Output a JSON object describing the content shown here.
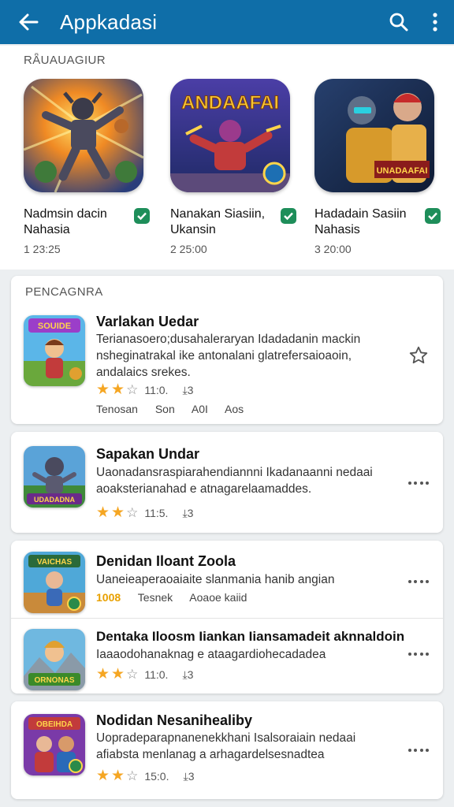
{
  "appbar": {
    "title": "Appkadasi",
    "colors": {
      "bar": "#0f6ea8"
    }
  },
  "featured": {
    "label": "RǞUAUAGIUR",
    "items": [
      {
        "name": "Nadmsin dacin Nahasia",
        "number": "1 23:25",
        "icon": "game-icon-warrior"
      },
      {
        "name": "Nanakan Siasiin, Ukansin",
        "number": "2 25:00",
        "icon": "game-icon-robot",
        "icon_text": "ANDAAFAI"
      },
      {
        "name": "Hadadain Sasiin Nahasis",
        "number": "3 20:00",
        "icon": "game-icon-soldier",
        "icon_text": "UNADAAFAI"
      }
    ]
  },
  "list": {
    "label": "PENCAGNRA",
    "first": {
      "title": "Varlakan Uedar",
      "desc": "Terianasoero;dusahaleraryan Idadadanin mackin nsheginatrakal ike antonalani glatrefersaioaoin, andalaics srekes.",
      "rating": "11:0.",
      "count": "3",
      "tags": [
        "Tenosan",
        "Son",
        "A0I",
        "Aos"
      ],
      "icon": "game-icon-adventure",
      "icon_text": "SOUIDE"
    },
    "cards": [
      {
        "title": "Sapakan Undar",
        "desc": "Uaonadansraspiarahendiannni Ikadanaanni nedaai aoaksterianahad e atnagarelaamaddes.",
        "rating": "11:5.",
        "count": "3",
        "icon": "game-icon-knight",
        "icon_text": "UDADADNA"
      },
      {
        "title": "Denidan Iloant Zoola",
        "desc": "Uaneieaperaoaiaite slanmania hanib angian",
        "badge": "1008",
        "tags": [
          "Tesnek",
          "Aoaoe kaiid"
        ],
        "icon": "game-icon-hero",
        "icon_text": "VAICHAS"
      },
      {
        "title": "Dentaka Iloosm Iiankan Iiansamadeit aknnaldoin",
        "desc": "Iaaaodohanaknag e ataagardiohecadadea",
        "rating": "11:0.",
        "count": "3",
        "icon": "game-icon-mage",
        "icon_text": "ORNONAS"
      },
      {
        "title": "Nodidan Nesanihealiby",
        "desc": "Uopradeparapnanenekkhani Isalsoraiain nedaai afiabsta menlanag a arhagardelsesnadtea",
        "rating": "15:0.",
        "count": "3",
        "icon": "game-icon-fighter",
        "icon_text": "OBEIHDA"
      }
    ]
  }
}
